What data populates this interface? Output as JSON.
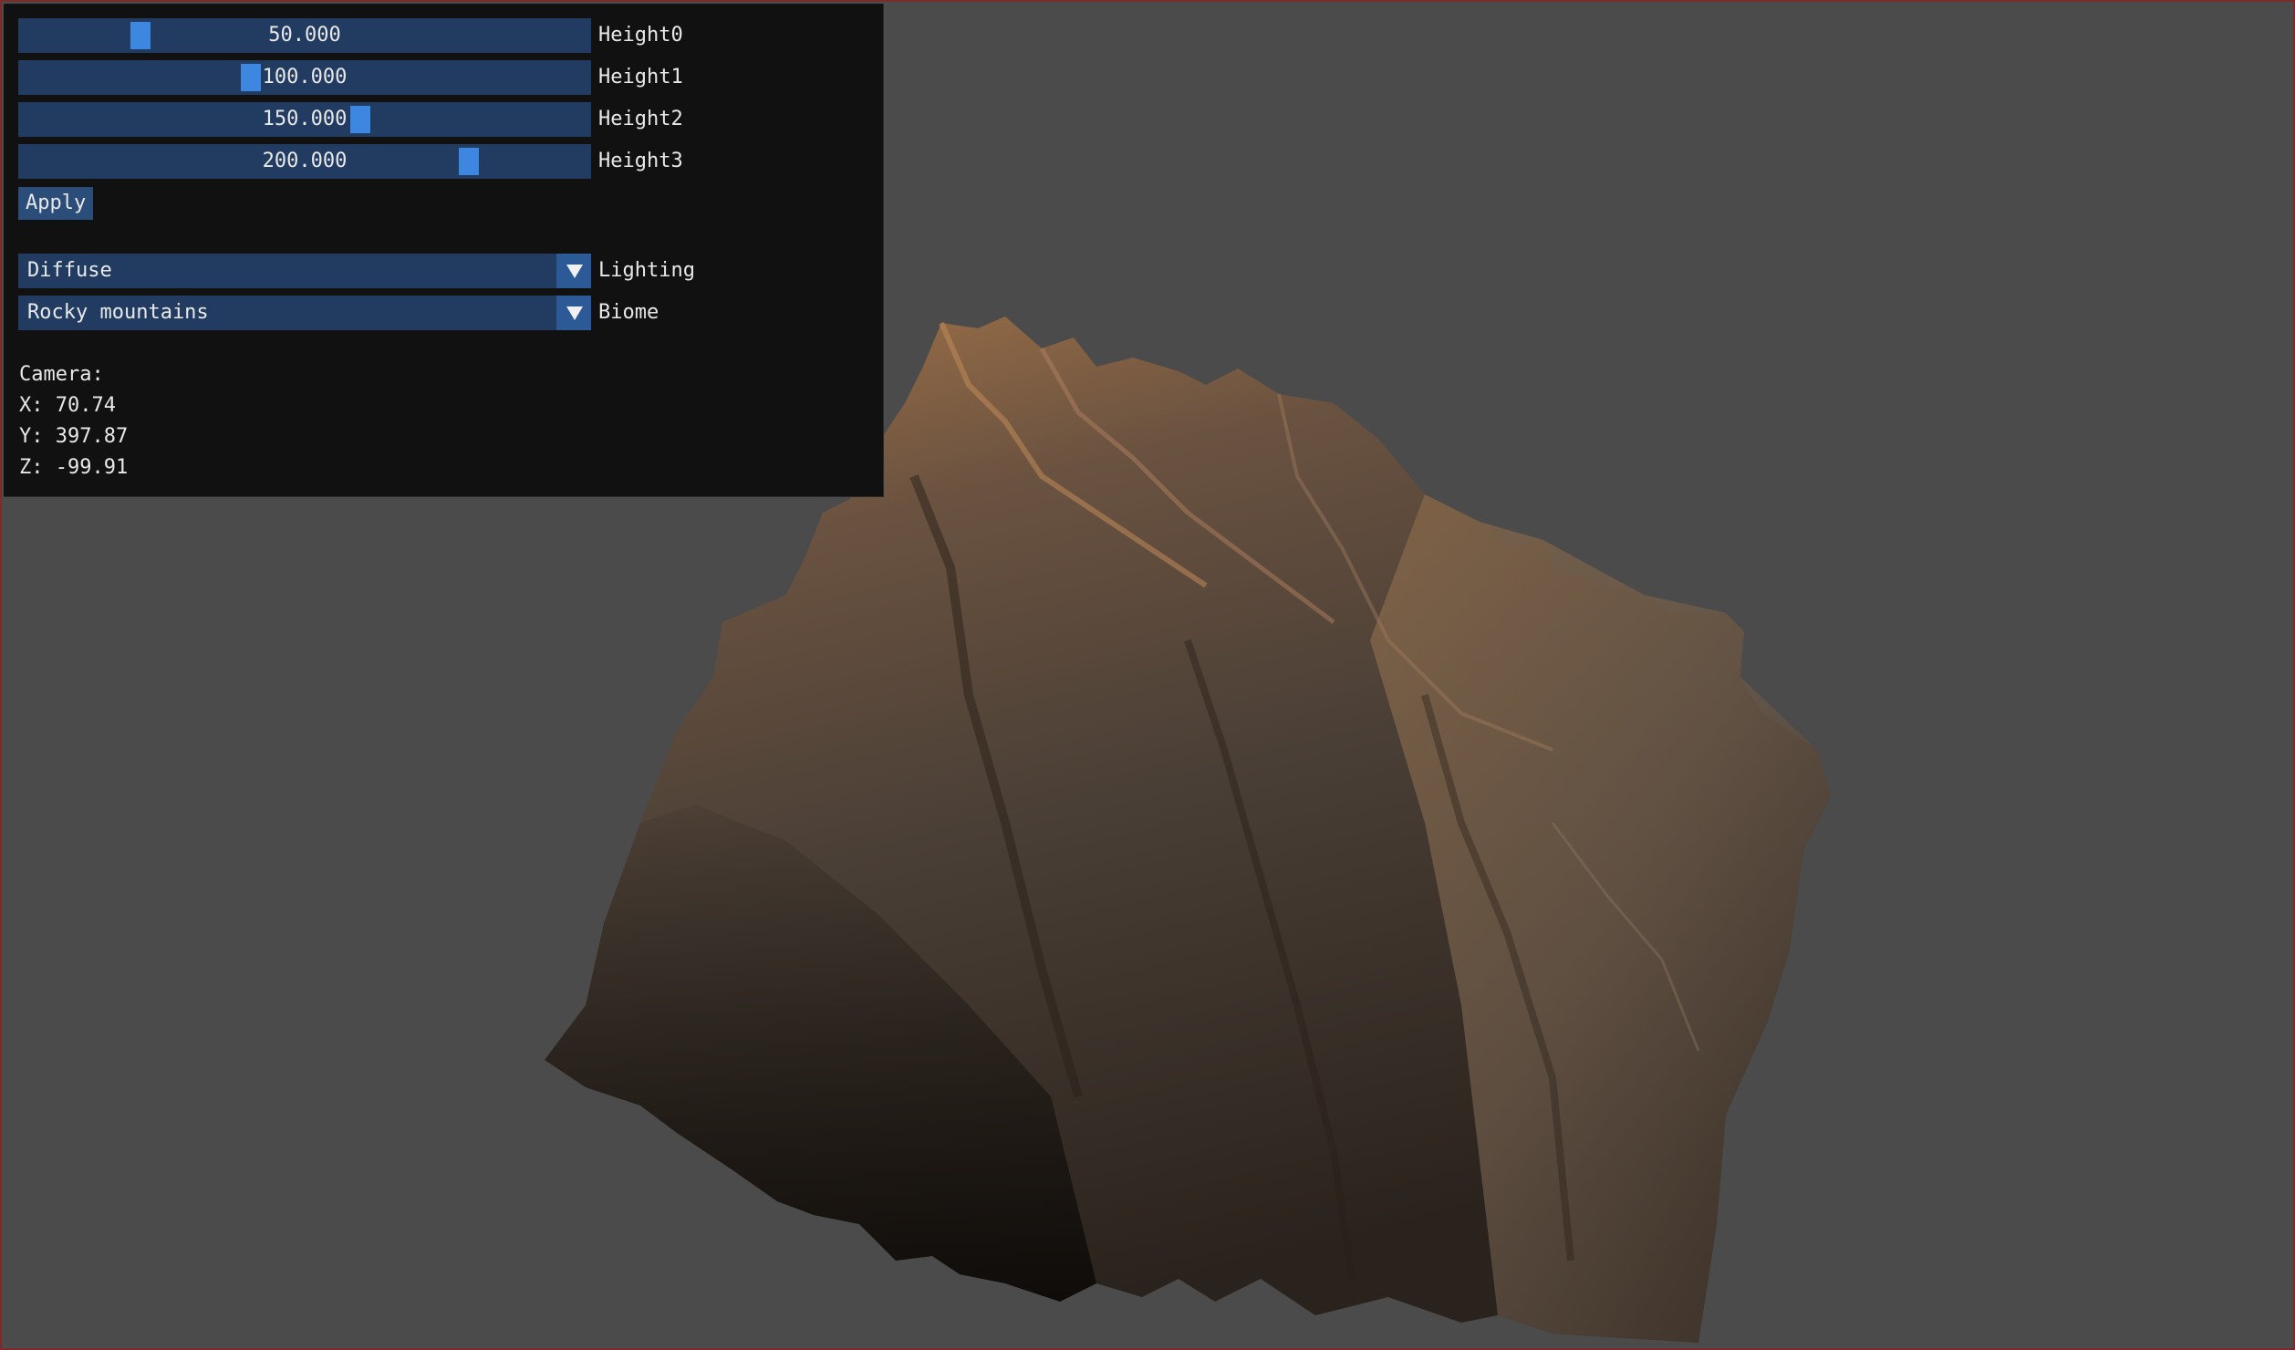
{
  "sliders": [
    {
      "label": "Height0",
      "value_text": "50.000",
      "fraction": 0.213
    },
    {
      "label": "Height1",
      "value_text": "100.000",
      "fraction": 0.406
    },
    {
      "label": "Height2",
      "value_text": "150.000",
      "fraction": 0.597
    },
    {
      "label": "Height3",
      "value_text": "200.000",
      "fraction": 0.787
    }
  ],
  "apply_label": "Apply",
  "lighting": {
    "label": "Lighting",
    "value": "Diffuse"
  },
  "biome": {
    "label": "Biome",
    "value": "Rocky mountains"
  },
  "camera": {
    "title": "Camera:",
    "x": "X: 70.74",
    "y": "Y: 397.87",
    "z": "Z: -99.91"
  },
  "colors": {
    "background": "#4b4b4b",
    "panel": "#111111",
    "widget": "#223c61",
    "accent": "#3d87e0"
  }
}
